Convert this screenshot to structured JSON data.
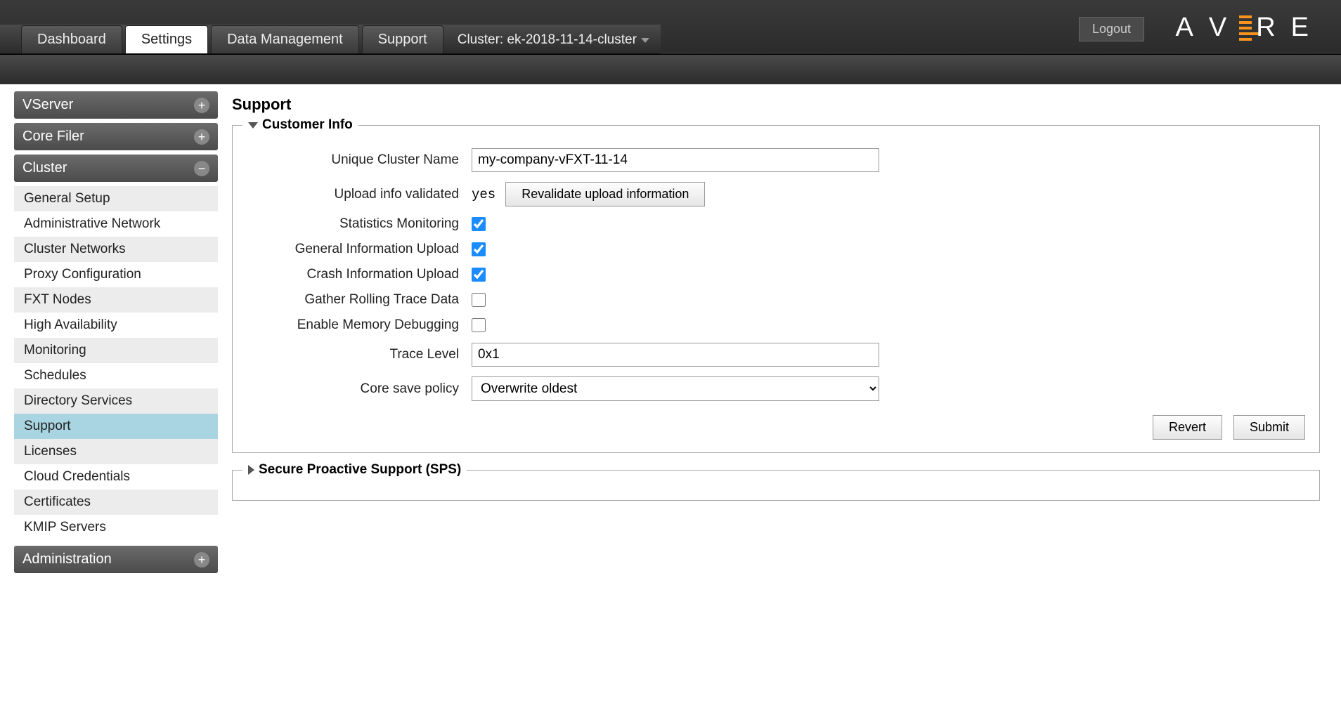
{
  "header": {
    "logout": "Logout"
  },
  "tabs": {
    "dashboard": "Dashboard",
    "settings": "Settings",
    "data_management": "Data Management",
    "support": "Support",
    "cluster_label": "Cluster: ek-2018-11-14-cluster"
  },
  "sidebar": {
    "vserver": "VServer",
    "core_filer": "Core Filer",
    "cluster": "Cluster",
    "administration": "Administration",
    "cluster_items": [
      "General Setup",
      "Administrative Network",
      "Cluster Networks",
      "Proxy Configuration",
      "FXT Nodes",
      "High Availability",
      "Monitoring",
      "Schedules",
      "Directory Services",
      "Support",
      "Licenses",
      "Cloud Credentials",
      "Certificates",
      "KMIP Servers"
    ]
  },
  "page": {
    "title": "Support",
    "customer_info_legend": "Customer Info",
    "sps_legend": "Secure Proactive Support (SPS)",
    "labels": {
      "unique_cluster_name": "Unique Cluster Name",
      "upload_info_validated": "Upload info validated",
      "statistics_monitoring": "Statistics Monitoring",
      "general_info_upload": "General Information Upload",
      "crash_info_upload": "Crash Information Upload",
      "gather_rolling_trace": "Gather Rolling Trace Data",
      "enable_memory_debug": "Enable Memory Debugging",
      "trace_level": "Trace Level",
      "core_save_policy": "Core save policy"
    },
    "values": {
      "unique_cluster_name": "my-company-vFXT-11-14",
      "upload_info_validated": "yes",
      "trace_level": "0x1",
      "core_save_policy": "Overwrite oldest"
    },
    "buttons": {
      "revalidate": "Revalidate upload information",
      "revert": "Revert",
      "submit": "Submit"
    }
  }
}
